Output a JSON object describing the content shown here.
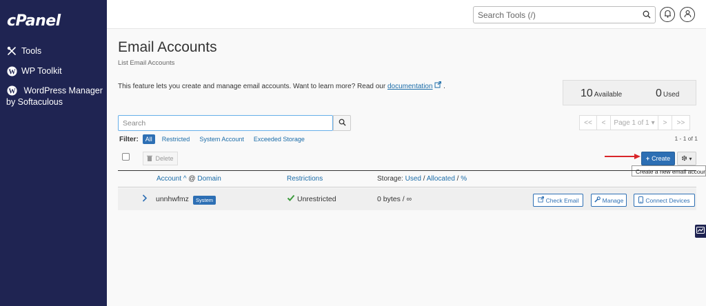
{
  "sidebar": {
    "logo": "cPanel",
    "items": [
      {
        "label": "Tools",
        "icon": "tools-icon"
      },
      {
        "label": "WP Toolkit",
        "icon": "wordpress-icon"
      },
      {
        "label": "WordPress Manager by Softaculous",
        "icon": "wordpress-icon"
      }
    ]
  },
  "header": {
    "search_placeholder": "Search Tools (/)",
    "icons": [
      "search-icon",
      "bell-icon",
      "user-icon"
    ]
  },
  "main": {
    "title": "Email Accounts",
    "subtitle": "List Email Accounts",
    "description": "This feature lets you create and manage email accounts. Want to learn more? Read our",
    "doc_link": "documentation",
    "desc_end": ".",
    "stats": {
      "available_count": "10",
      "available_label": "Available",
      "used_count": "0",
      "used_label": "Used"
    },
    "search_placeholder": "Search",
    "filter": {
      "label": "Filter:",
      "options": [
        "All",
        "Restricted",
        "System Account",
        "Exceeded Storage"
      ],
      "active": "All"
    },
    "pagination": {
      "first": "<<",
      "prev": "<",
      "page": "Page 1 of 1",
      "next": ">",
      "last": ">>",
      "range": "1 - 1 of 1"
    },
    "delete_label": "Delete",
    "create_label": "Create",
    "create_tooltip": "Create a new email account.",
    "table": {
      "account_col": "Account",
      "at": "@",
      "domain_col": "Domain",
      "restrictions_col": "Restrictions",
      "storage_col": "Storage:",
      "used": "Used",
      "sep": "/",
      "allocated": "Allocated",
      "percent": "%",
      "rows": [
        {
          "account": "unnhwfmz",
          "badge": "System",
          "restriction": "Unrestricted",
          "storage": "0 bytes / ∞",
          "actions": [
            "Check Email",
            "Manage",
            "Connect Devices"
          ]
        }
      ]
    }
  },
  "colors": {
    "sidebar": "#1f2452",
    "primary": "#2d6fb4",
    "link": "#1b6ca8",
    "success": "#3c9b3c",
    "arrow": "#d9262a"
  }
}
